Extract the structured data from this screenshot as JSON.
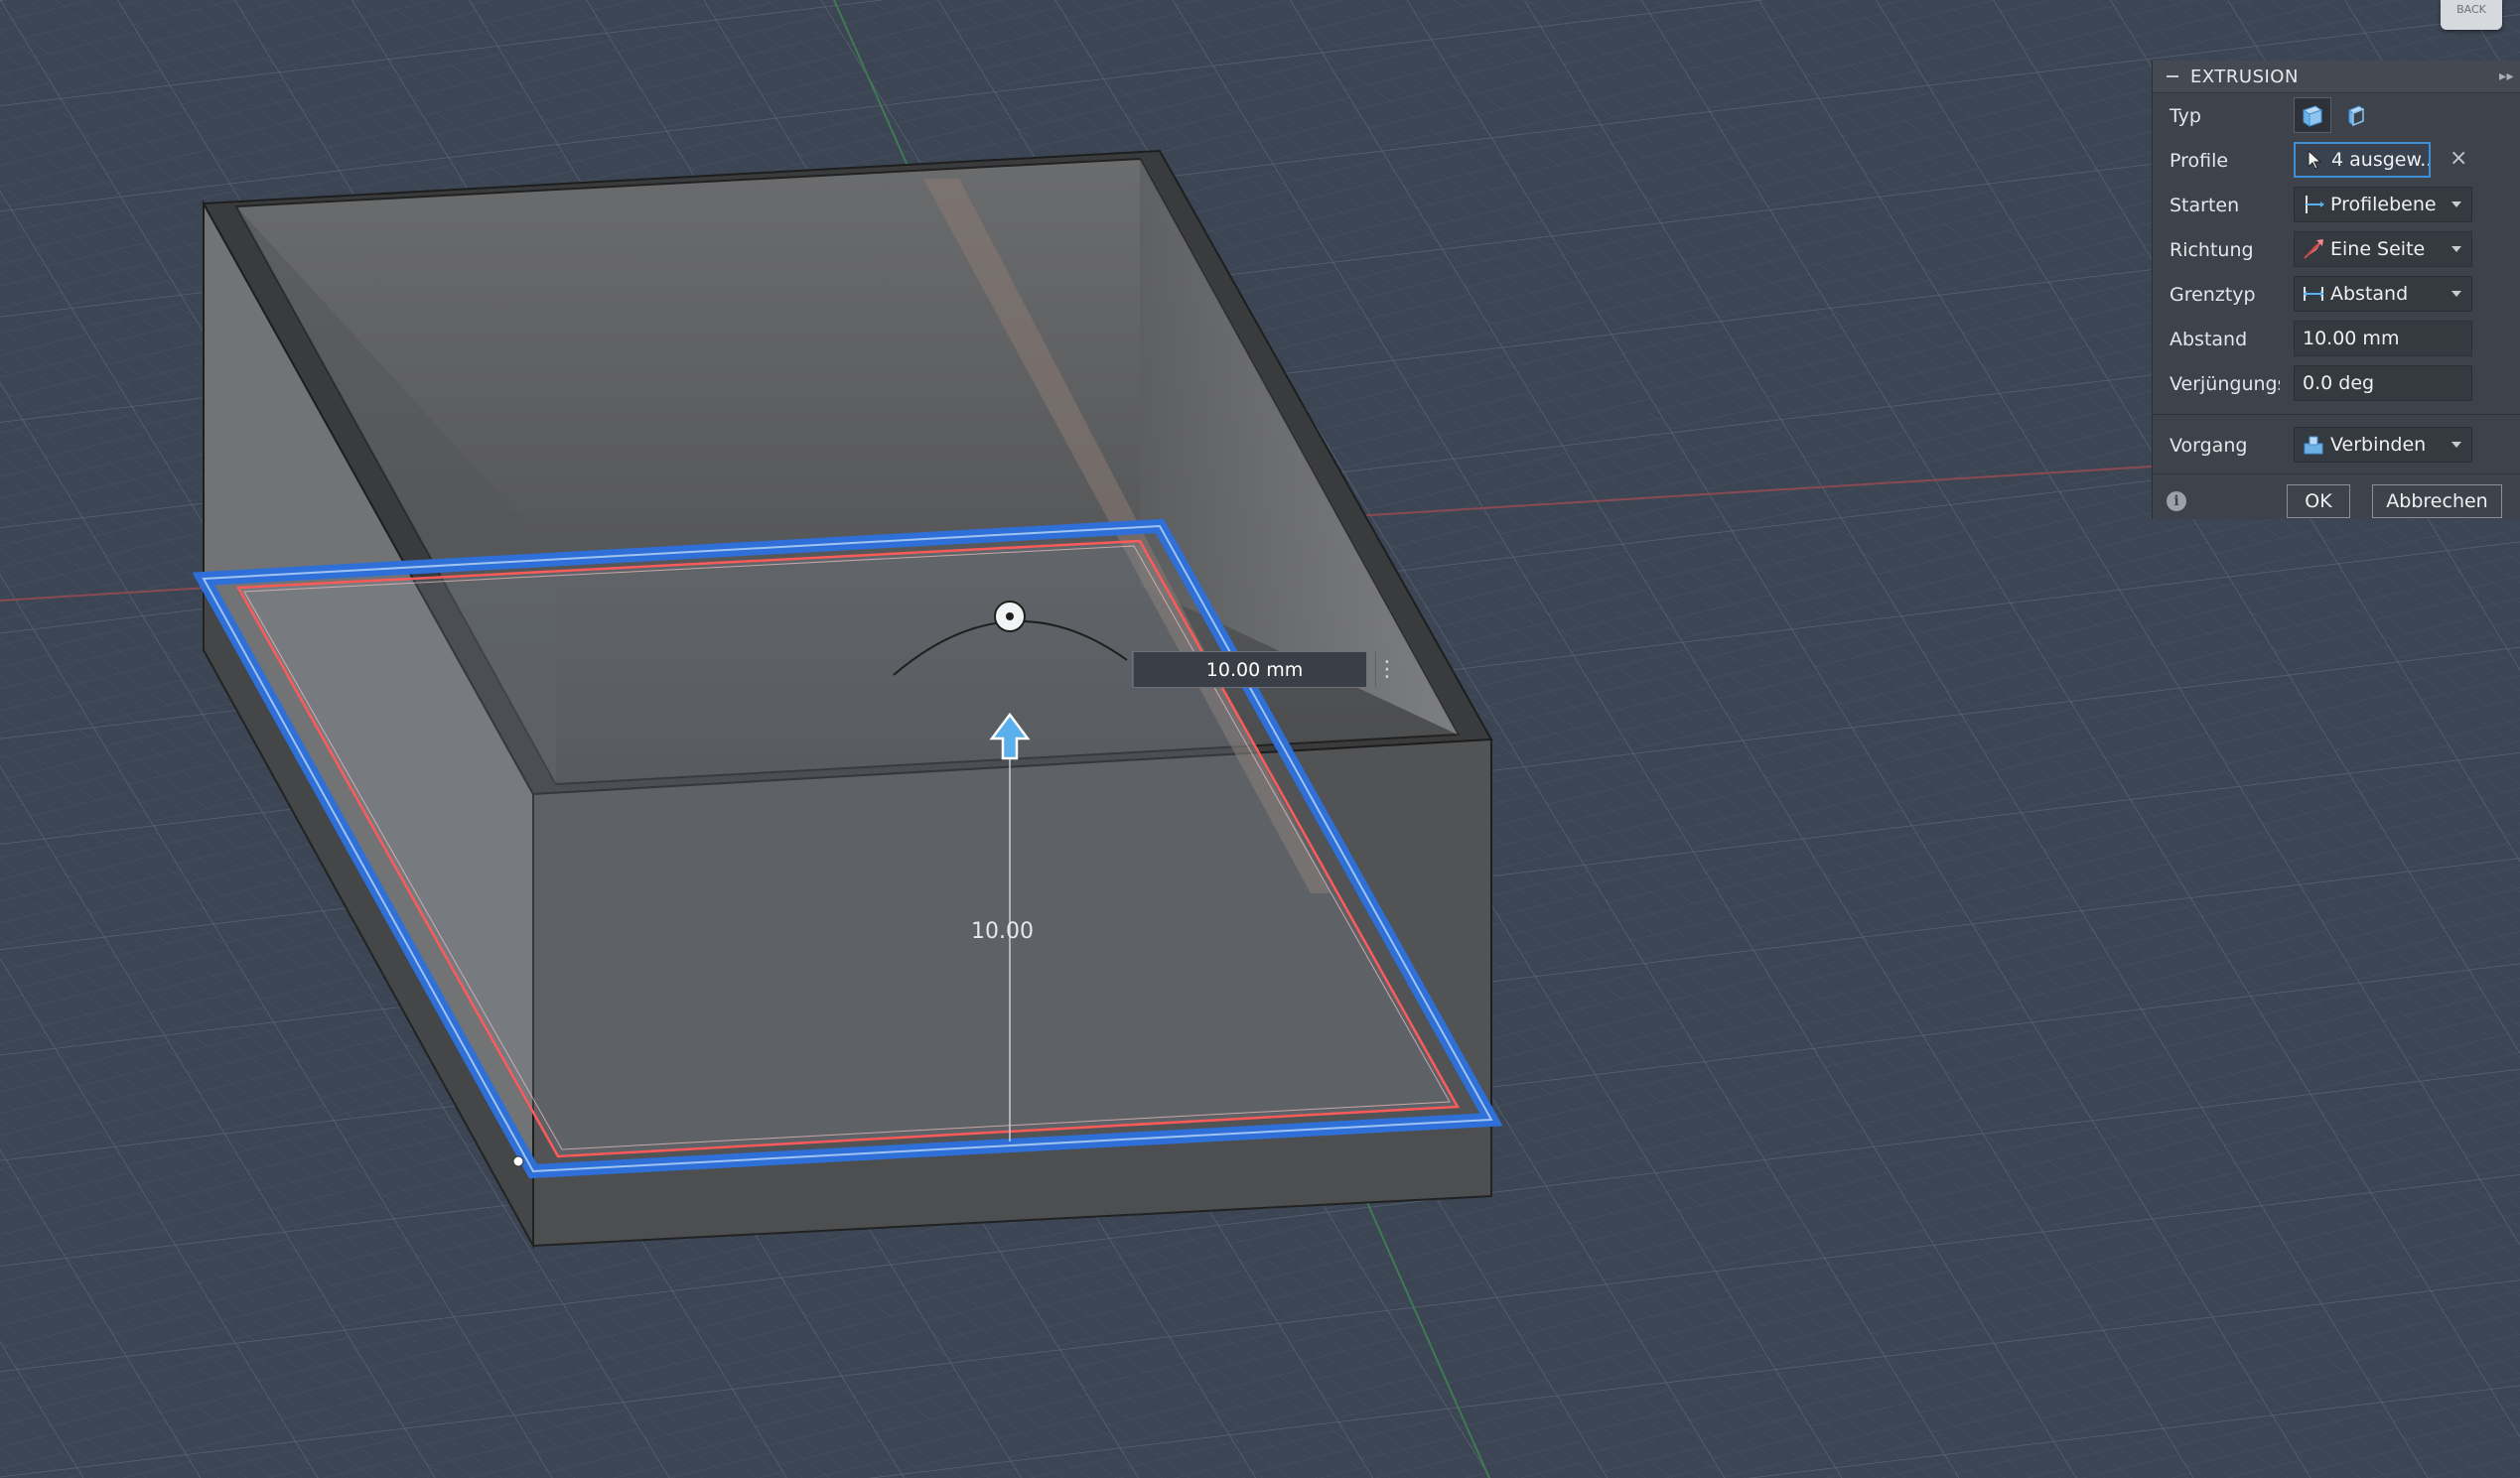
{
  "viewport": {
    "dimension_input_value": "10.00 mm",
    "dimension_label": "10.00",
    "view_cube_label": "BACK"
  },
  "panel": {
    "title": "EXTRUSION",
    "rows": {
      "typ": {
        "label": "Typ"
      },
      "profile": {
        "label": "Profile",
        "value": "4 ausgew..."
      },
      "starten": {
        "label": "Starten",
        "value": "Profilebene"
      },
      "richtung": {
        "label": "Richtung",
        "value": "Eine Seite"
      },
      "grenztyp": {
        "label": "Grenztyp",
        "value": "Abstand"
      },
      "abstand": {
        "label": "Abstand",
        "value": "10.00 mm"
      },
      "verjuengung": {
        "label": "Verjüngungs...",
        "value": "0.0 deg"
      },
      "vorgang": {
        "label": "Vorgang",
        "value": "Verbinden"
      }
    },
    "ok_label": "OK",
    "cancel_label": "Abbrechen"
  },
  "colors": {
    "background": "#3b4554",
    "selection_blue": "#2f6fd8",
    "profile_red": "#ff5a5a",
    "body_gray": "#5a5b5d",
    "accent": "#3f8fd6"
  }
}
